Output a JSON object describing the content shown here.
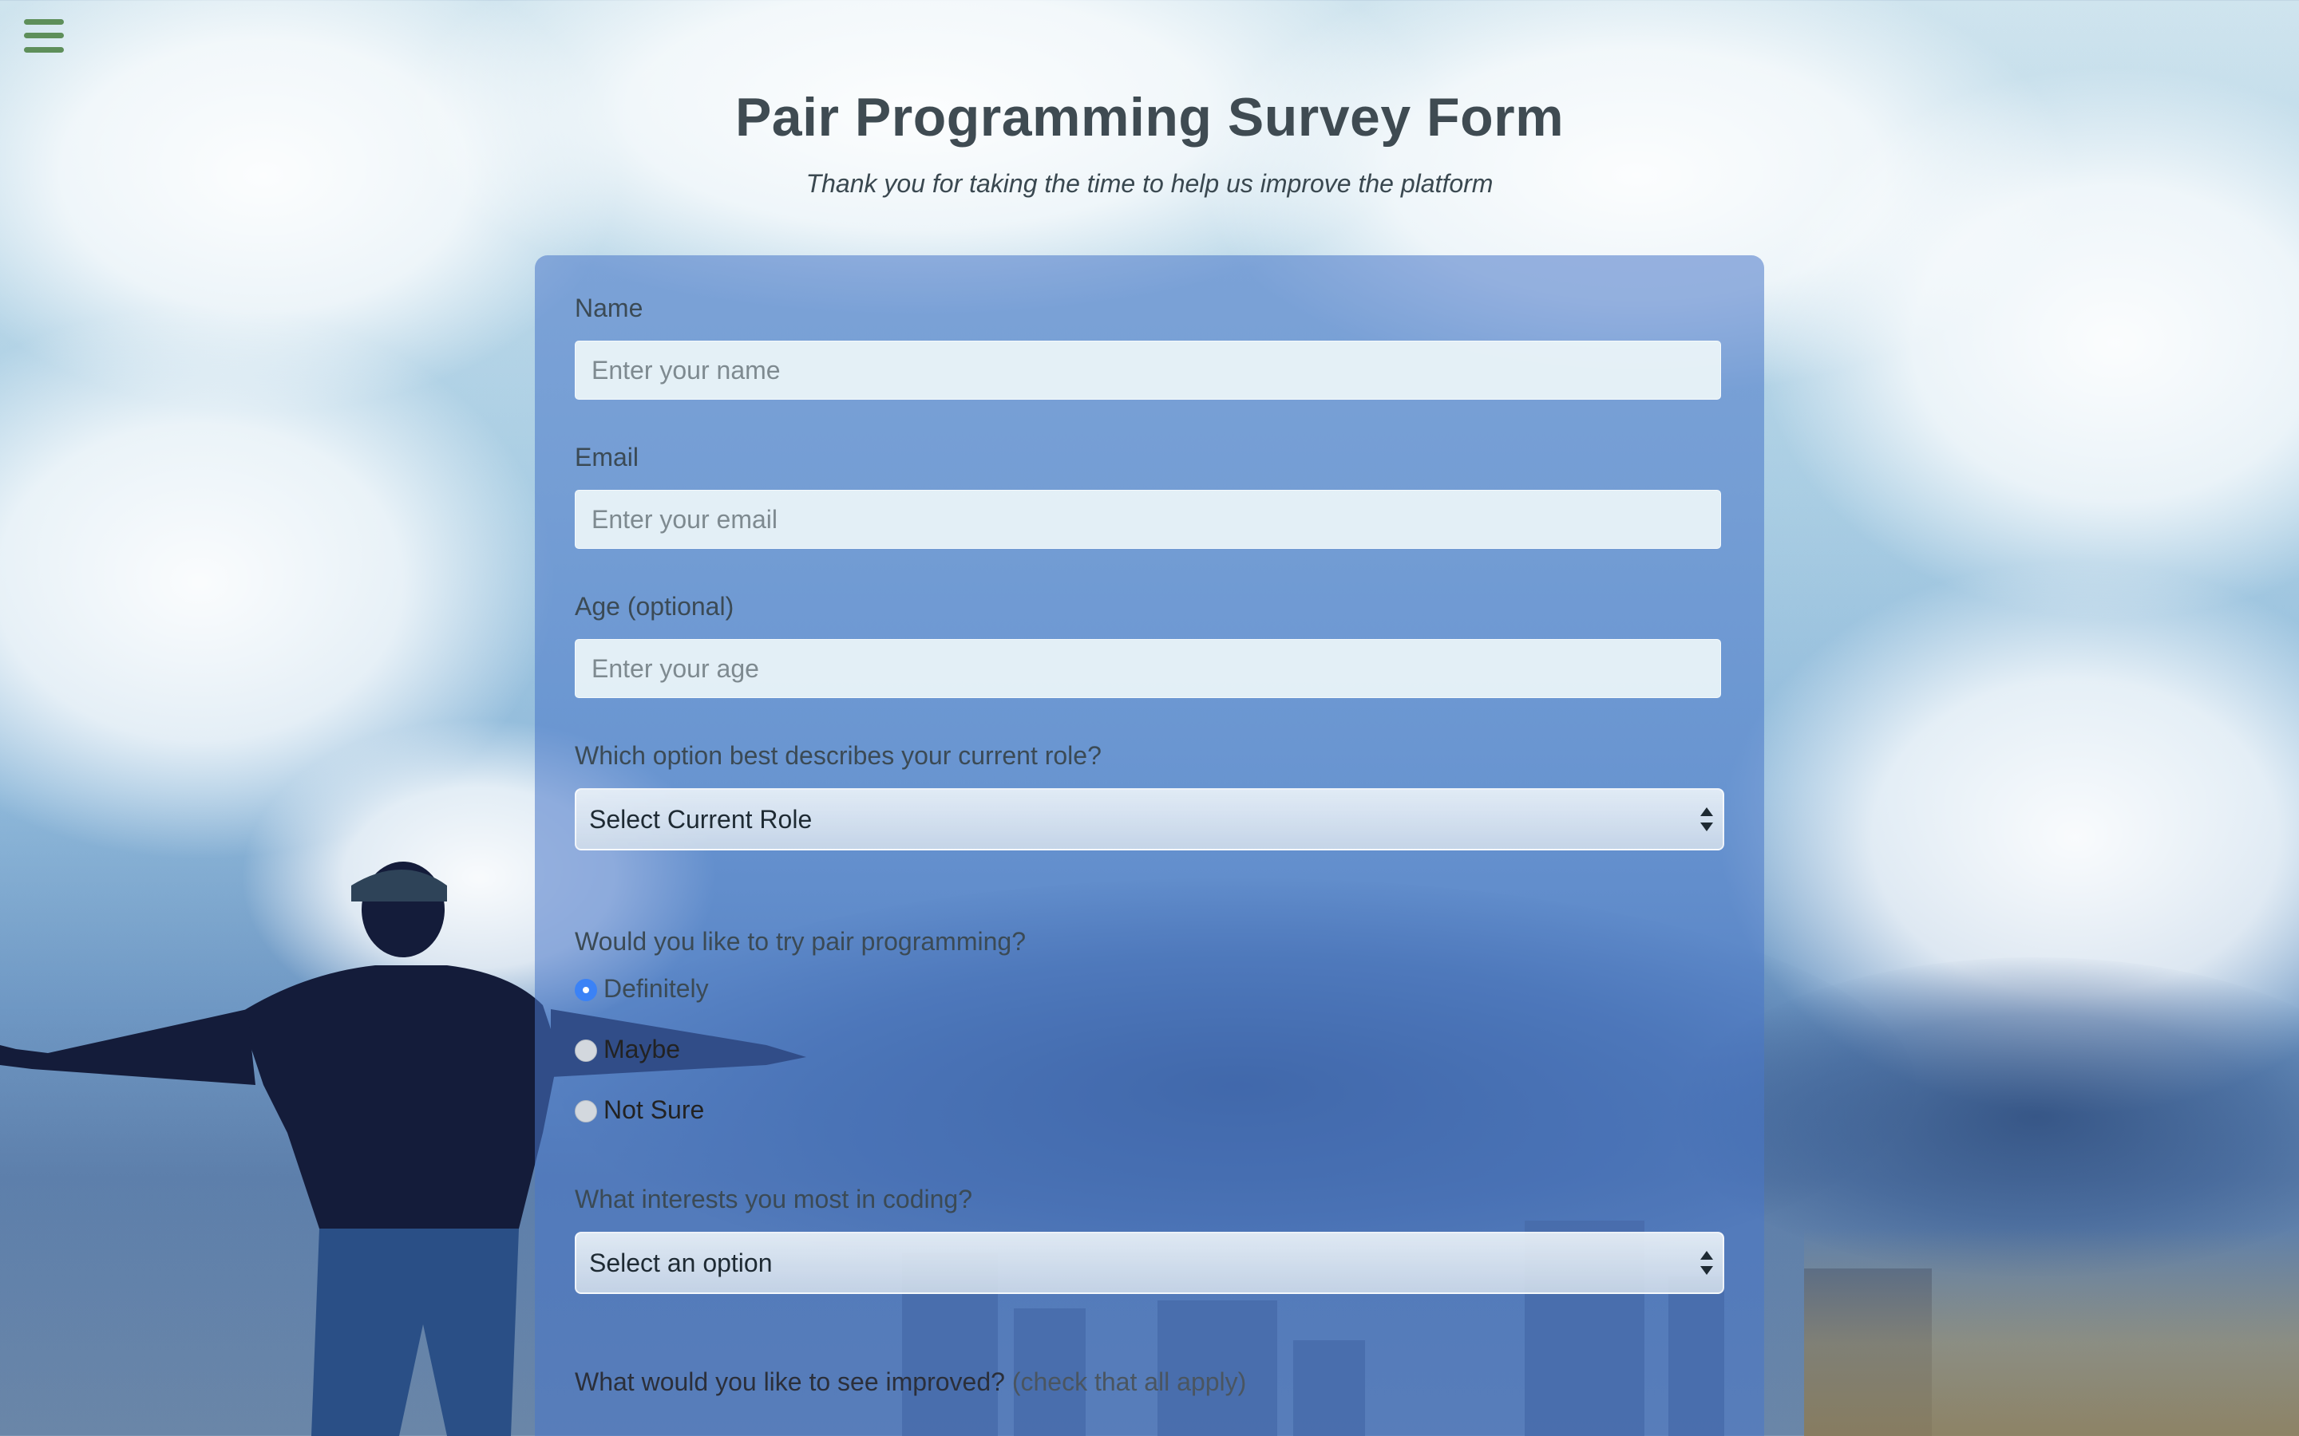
{
  "page": {
    "title": "Pair Programming Survey Form",
    "subtitle": "Thank you for taking the time to help us improve the platform"
  },
  "form": {
    "name": {
      "label": "Name",
      "placeholder": "Enter your name"
    },
    "email": {
      "label": "Email",
      "placeholder": "Enter your email"
    },
    "age": {
      "label": "Age (optional)",
      "placeholder": "Enter your age"
    },
    "role": {
      "label": "Which option best describes your current role?",
      "selected": "Select Current Role"
    },
    "pair_programming": {
      "label": "Would you like to try pair programming?",
      "options": [
        "Definitely",
        "Maybe",
        "Not Sure"
      ],
      "selected": "Definitely"
    },
    "interests": {
      "label": "What interests you most in coding?",
      "selected": "Select an option"
    },
    "improvements": {
      "label": "What would you like to see improved?",
      "hint": "(check that all apply)"
    }
  },
  "icons": {
    "menu": "hamburger-menu-icon"
  },
  "colors": {
    "menu_icon": "#5e8f5a",
    "card_bg": "rgba(72,118,200,0.55)",
    "radio_checked": "#3b82f6",
    "title": "#3f4b52"
  }
}
